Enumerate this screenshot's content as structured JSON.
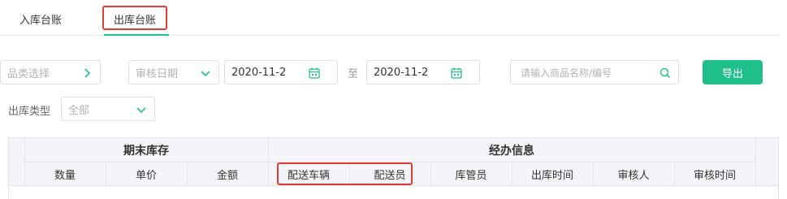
{
  "tabs": [
    {
      "label": "入库台账",
      "active": false
    },
    {
      "label": "出库台账",
      "active": true
    }
  ],
  "filters": {
    "category_placeholder": "品类选择",
    "audit_date_placeholder": "审核日期",
    "date_start": "2020-11-2",
    "date_to_label": "至",
    "date_end": "2020-11-2",
    "search_placeholder": "请输入商品名称/编号",
    "export_label": "导出",
    "type_label": "出库类型",
    "type_value": "全部"
  },
  "table": {
    "groups": [
      "期末库存",
      "经办信息"
    ],
    "columns": [
      "数量",
      "单价",
      "金额",
      "配送车辆",
      "配送员",
      "库管员",
      "出库时间",
      "审核人",
      "审核时间"
    ]
  },
  "colors": {
    "accent": "#1fbf8c",
    "annotation": "#e53935",
    "header_bg": "#f4f5f8"
  }
}
